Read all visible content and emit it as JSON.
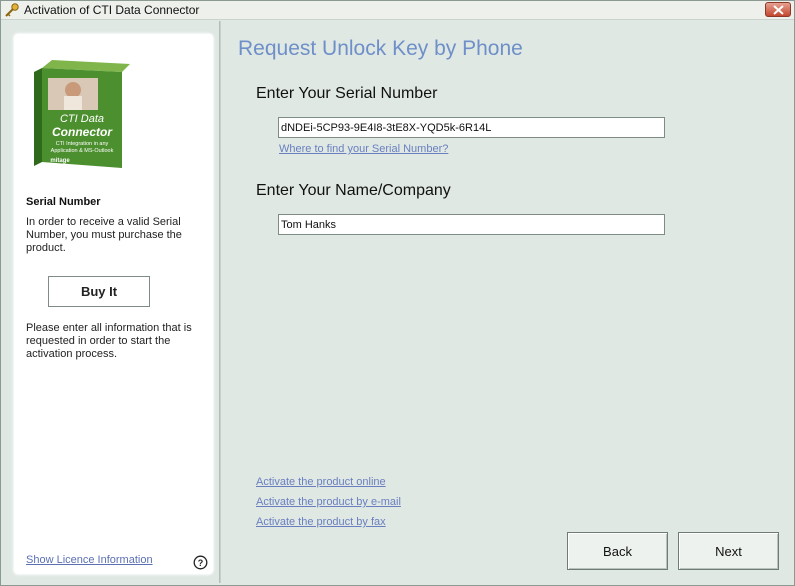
{
  "window": {
    "title": "Activation of CTI Data Connector",
    "close_icon": "close-icon",
    "app_icon": "key-icon"
  },
  "sidebar": {
    "product_image": "product-box-image",
    "product_box_text": {
      "line1": "CTI Data",
      "line2": "Connector",
      "line3": "CTI Integration in any",
      "line4": "Application & MS-Outlook",
      "brand": "mitage"
    },
    "serial_heading": "Serial Number",
    "serial_text": "In order to receive a valid Serial Number, you must purchase the product.",
    "buy_label": "Buy It",
    "info_text": "Please enter all information that is requested in order to start the activation process.",
    "licence_link": "Show Licence Information",
    "help_icon": "help-icon"
  },
  "main": {
    "title": "Request Unlock Key by Phone",
    "serial_label": "Enter Your Serial Number",
    "serial_value": "dNDEi-5CP93-9E4I8-3tE8X-YQD5k-6R14L",
    "serial_help_link": "Where to find your Serial Number?",
    "name_label": "Enter Your Name/Company",
    "name_value": "Tom Hanks",
    "links": {
      "online": "Activate the product online",
      "email": "Activate the product by e-mail",
      "fax": "Activate the product by fax"
    }
  },
  "footer": {
    "back_label": "Back",
    "next_label": "Next"
  },
  "colors": {
    "background": "#dfe8e3",
    "title_accent": "#6e8fc8",
    "link": "#6a7fc0",
    "close_button": "#c3472e"
  }
}
